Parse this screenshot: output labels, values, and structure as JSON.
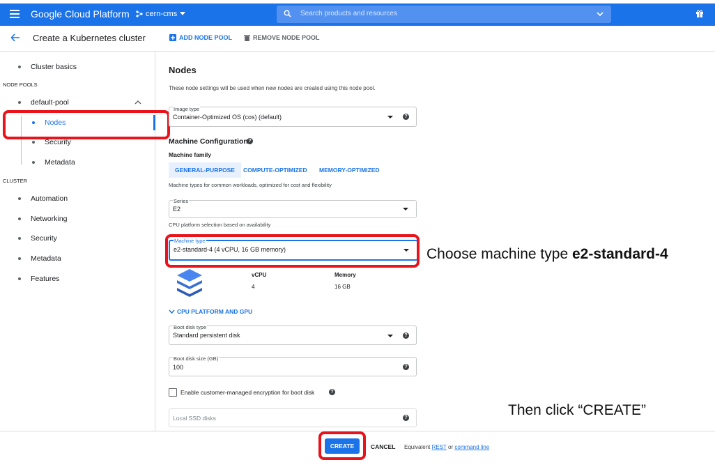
{
  "header": {
    "brand": "Google Cloud Platform",
    "project": "cern-cms",
    "search_placeholder": "Search products and resources"
  },
  "actions": {
    "page_title": "Create a Kubernetes cluster",
    "add_node_pool": "ADD NODE POOL",
    "remove_node_pool": "REMOVE NODE POOL"
  },
  "sidebar": {
    "cluster_basics": "Cluster basics",
    "node_pools_heading": "NODE POOLS",
    "default_pool": "default-pool",
    "pool_items": [
      "Nodes",
      "Security",
      "Metadata"
    ],
    "cluster_heading": "CLUSTER",
    "cluster_items": [
      "Automation",
      "Networking",
      "Security",
      "Metadata",
      "Features"
    ]
  },
  "main": {
    "title": "Nodes",
    "description": "These node settings will be used when new nodes are created using this node pool.",
    "image_type": {
      "label": "Image type",
      "value": "Container-Optimized OS (cos) (default)"
    },
    "machine_config_title": "Machine Configuration",
    "machine_family_label": "Machine family",
    "family_tabs": [
      "GENERAL-PURPOSE",
      "COMPUTE-OPTIMIZED",
      "MEMORY-OPTIMIZED"
    ],
    "family_desc": "Machine types for common workloads, optimized for cost and flexibility",
    "series": {
      "label": "Series",
      "value": "E2"
    },
    "series_desc": "CPU platform selection based on availability",
    "machine_type": {
      "label": "Machine type",
      "value": "e2-standard-4 (4 vCPU, 16 GB memory)"
    },
    "vcpu_label": "vCPU",
    "vcpu_value": "4",
    "memory_label": "Memory",
    "memory_value": "16 GB",
    "cpu_platform_toggle": "CPU PLATFORM AND GPU",
    "boot_disk_type": {
      "label": "Boot disk type",
      "value": "Standard persistent disk"
    },
    "boot_disk_size": {
      "label": "Boot disk size (GB)",
      "value": "100"
    },
    "encryption_label": "Enable customer-managed encryption for boot disk",
    "local_ssd_placeholder": "Local SSD disks"
  },
  "footer": {
    "create": "CREATE",
    "cancel": "CANCEL",
    "equiv_prefix": "Equivalent",
    "rest": "REST",
    "or": "or",
    "command_line": "command line"
  },
  "annotations": {
    "machine_prefix": "Choose machine type ",
    "machine_bold": "e2-standard-4",
    "create_note": "Then click “CREATE”"
  },
  "colors": {
    "primary": "#1a73e8",
    "highlight": "#e8131b"
  }
}
